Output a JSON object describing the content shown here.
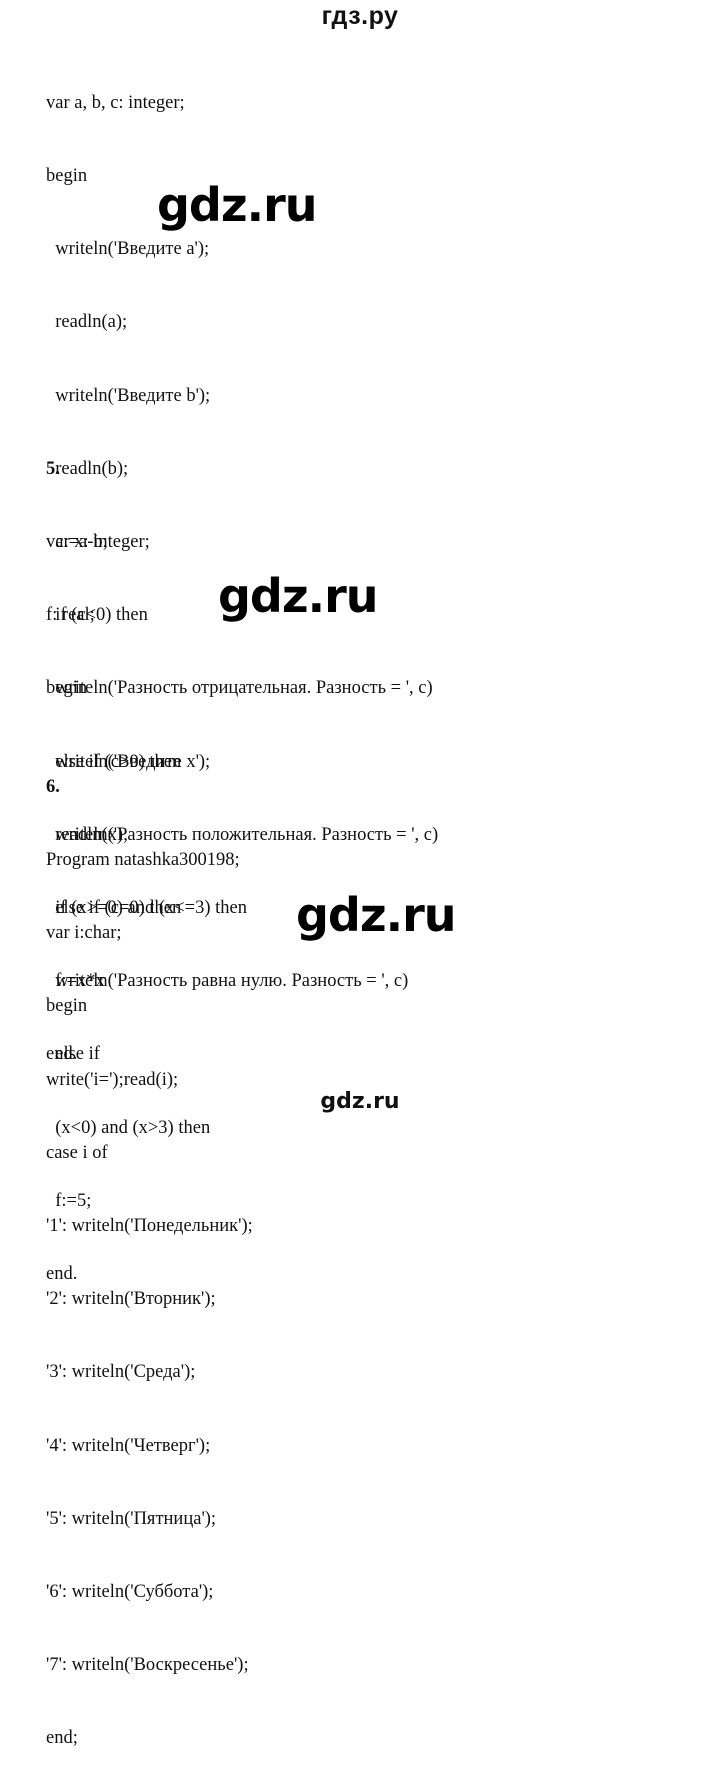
{
  "header": {
    "site_title": "гдз.ру"
  },
  "block4": {
    "lines": [
      "var a, b, c: integer;",
      "begin",
      "  writeln('Введите a');",
      "  readln(a);",
      "  writeln('Введите b');",
      "  readln(b);",
      "  c:=a-b;",
      "  if (c<0) then",
      "  writeln('Разность отрицательная. Разность = ', c)",
      "  else if (c>0) then",
      "  writeln('Разность положительная. Разность = ', c)",
      "  else if (c=0) then",
      "  writeln('Разность равна нулю. Разность = ', c)",
      "end."
    ]
  },
  "block5": {
    "number": "5.",
    "lines": [
      "var x: integer;",
      "f: real;",
      "begin",
      "  writeln('Введите x');",
      "  readln(x);",
      "  if (x>=0) and (x<=3) then",
      "  f:=x*x",
      "  else if",
      "  (x<0) and (x>3) then",
      "  f:=5;",
      "end."
    ]
  },
  "block6": {
    "number": "6.",
    "lines": [
      "Program natashka300198;",
      "var i:char;",
      "begin",
      "write('i=');read(i);",
      "case i of",
      "'1': writeln('Понедельник');",
      "'2': writeln('Вторник');",
      "'3': writeln('Среда');",
      "'4': writeln('Четверг');",
      "'5': writeln('Пятница');",
      "'6': writeln('Суббота');",
      "'7': writeln('Воскресенье');",
      "end;"
    ]
  },
  "watermarks": [
    "gdz.ru",
    "gdz.ru",
    "gdz.ru"
  ],
  "footer": {
    "site": "gdz.ru"
  }
}
